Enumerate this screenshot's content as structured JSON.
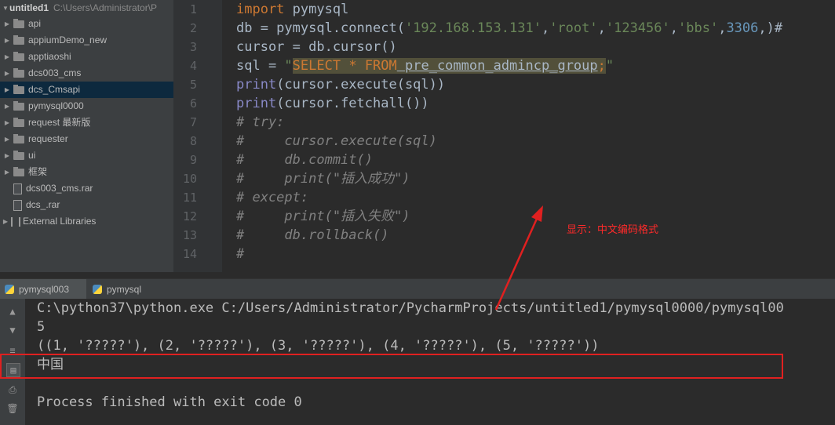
{
  "project_tree": {
    "root_name": "untitled1",
    "root_path": "C:\\Users\\Administrator\\P",
    "items": [
      {
        "label": "api",
        "kind": "folder"
      },
      {
        "label": "appiumDemo_new",
        "kind": "folder"
      },
      {
        "label": "apptiaoshi",
        "kind": "folder"
      },
      {
        "label": "dcs003_cms",
        "kind": "folder"
      },
      {
        "label": "dcs_Cmsapi",
        "kind": "folder",
        "selected": true
      },
      {
        "label": "pymysql0000",
        "kind": "folder"
      },
      {
        "label": "request 最新版",
        "kind": "folder"
      },
      {
        "label": "requester",
        "kind": "folder"
      },
      {
        "label": "ui",
        "kind": "folder"
      },
      {
        "label": "框架",
        "kind": "folder"
      },
      {
        "label": "dcs003_cms.rar",
        "kind": "file"
      },
      {
        "label": "dcs_.rar",
        "kind": "file"
      }
    ],
    "external_libraries": "External Libraries"
  },
  "editor": {
    "line_numbers": [
      "1",
      "2",
      "3",
      "4",
      "5",
      "6",
      "7",
      "8",
      "9",
      "10",
      "11",
      "12",
      "13",
      "14"
    ],
    "code": {
      "l1_kw": "import",
      "l1_rest": " pymysql",
      "l2_a": "db = pymysql.connect(",
      "l2_s1": "'192.168.153.131'",
      "l2_s2": "'root'",
      "l2_s3": "'123456'",
      "l2_s4": "'bbs'",
      "l2_num": "3306",
      "l2_end": ",)#",
      "l3": "cursor = db.cursor()",
      "l4_a": "sql = ",
      "l4_q": "\"",
      "l4_sel": "SELECT",
      "l4_star": " * ",
      "l4_from": "FROM",
      "l4_tbl": " pre_common_admincp_group",
      "l4_semi": ";",
      "l4_q2": "\"",
      "l5_fn": "print",
      "l5_rest": "(cursor.execute(sql))",
      "l6_fn": "print",
      "l6_rest": "(cursor.fetchall())",
      "l7": "# try:",
      "l8": "#     cursor.execute(sql)",
      "l9": "#     db.commit()",
      "l10": "#     print(\"插入成功\")",
      "l11": "# except:",
      "l12": "#     print(\"插入失败\")",
      "l13": "#     db.rollback()",
      "l14": "#"
    },
    "annotation": "显示：中文编码格式"
  },
  "run_tabs": [
    "pymysql003",
    "pymysql"
  ],
  "console": {
    "command": "C:\\python37\\python.exe C:/Users/Administrator/PycharmProjects/untitled1/pymysql0000/pymysql00",
    "line2": "5",
    "line3": "((1, '?????'), (2, '?????'), (3, '?????'), (4, '?????'), (5, '?????'))",
    "line4": "中国",
    "line6": "Process finished with exit code 0"
  },
  "colors": {
    "keyword": "#cc7832",
    "string": "#6a8759",
    "number": "#6897bb",
    "comment": "#808080",
    "highlight_box": "#e02020",
    "annotation": "#ff2a2a"
  }
}
